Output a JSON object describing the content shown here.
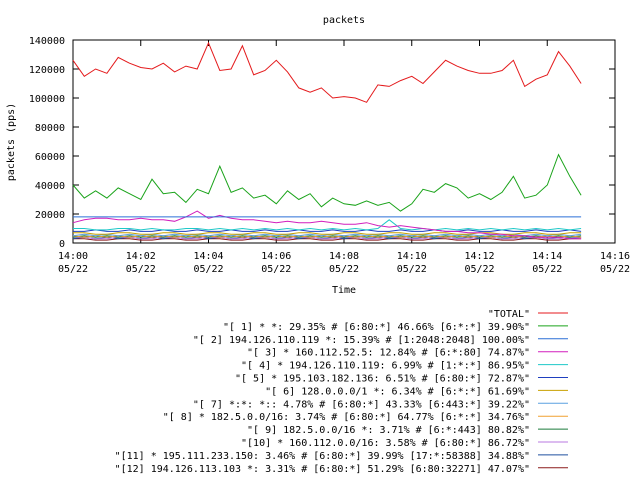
{
  "chart_data": {
    "type": "line",
    "title": "packets",
    "xlabel": "Time",
    "ylabel": "packets (pps)",
    "ylim": [
      0,
      140000
    ],
    "xlim": [
      "14:00",
      "14:16"
    ],
    "y_ticks": [
      "0",
      "20000",
      "40000",
      "60000",
      "80000",
      "100000",
      "120000",
      "140000"
    ],
    "x_ticks": [
      {
        "time": "14:00",
        "date": "05/22"
      },
      {
        "time": "14:02",
        "date": "05/22"
      },
      {
        "time": "14:04",
        "date": "05/22"
      },
      {
        "time": "14:06",
        "date": "05/22"
      },
      {
        "time": "14:08",
        "date": "05/22"
      },
      {
        "time": "14:10",
        "date": "05/22"
      },
      {
        "time": "14:12",
        "date": "05/22"
      },
      {
        "time": "14:14",
        "date": "05/22"
      },
      {
        "time": "14:16",
        "date": "05/22"
      }
    ],
    "grid": false,
    "legend_position": "bottom",
    "x": [
      "14:00:00",
      "14:00:20",
      "14:00:40",
      "14:01:00",
      "14:01:20",
      "14:01:40",
      "14:02:00",
      "14:02:20",
      "14:02:40",
      "14:03:00",
      "14:03:20",
      "14:03:40",
      "14:04:00",
      "14:04:20",
      "14:04:40",
      "14:05:00",
      "14:05:20",
      "14:05:40",
      "14:06:00",
      "14:06:20",
      "14:06:40",
      "14:07:00",
      "14:07:20",
      "14:07:40",
      "14:08:00",
      "14:08:20",
      "14:08:40",
      "14:09:00",
      "14:09:20",
      "14:09:40",
      "14:10:00",
      "14:10:20",
      "14:10:40",
      "14:11:00",
      "14:11:20",
      "14:11:40",
      "14:12:00",
      "14:12:20",
      "14:12:40",
      "14:13:00",
      "14:13:20",
      "14:13:40",
      "14:14:00",
      "14:14:20",
      "14:14:40",
      "14:15:00"
    ],
    "series": [
      {
        "name": "\"TOTAL\"",
        "color": "#e41a1c",
        "values": [
          126000,
          115000,
          120000,
          117000,
          128000,
          124000,
          121000,
          120000,
          124000,
          118000,
          122000,
          120000,
          138000,
          119000,
          120000,
          136000,
          116000,
          119000,
          126000,
          118000,
          107000,
          104000,
          107000,
          100000,
          101000,
          100000,
          97000,
          109000,
          108000,
          112000,
          115000,
          110000,
          118000,
          126000,
          122000,
          119000,
          117000,
          117000,
          119000,
          126000,
          108000,
          113000,
          116000,
          132000,
          122000,
          110000
        ]
      },
      {
        "name": "\"[ 1] * *: 29.35% # [6:80:*] 46.66% [6:*:*] 39.90%\"",
        "color": "#1aa31a",
        "values": [
          40000,
          31000,
          36000,
          31000,
          38000,
          34000,
          30000,
          44000,
          34000,
          35000,
          28000,
          37000,
          34000,
          53000,
          35000,
          38000,
          31000,
          33000,
          27000,
          36000,
          30000,
          34000,
          25000,
          31000,
          27000,
          26000,
          29000,
          26000,
          28000,
          22000,
          27000,
          37000,
          35000,
          41000,
          38000,
          31000,
          34000,
          30000,
          35000,
          46000,
          31000,
          33000,
          40000,
          61000,
          46000,
          33000
        ]
      },
      {
        "name": "\"[ 2] 194.126.110.119 *: 15.39% # [1:2048:2048] 100.00%\"",
        "color": "#2a6fd6",
        "values": [
          18000,
          18000,
          18000,
          18000,
          18000,
          18000,
          18000,
          18000,
          18000,
          18000,
          18000,
          18000,
          18000,
          18000,
          18000,
          18000,
          18000,
          18000,
          18000,
          18000,
          18000,
          18000,
          18000,
          18000,
          18000,
          18000,
          18000,
          18000,
          18000,
          18000,
          18000,
          18000,
          18000,
          18000,
          18000,
          18000,
          18000,
          18000,
          18000,
          18000,
          18000,
          18000,
          18000,
          18000,
          18000,
          18000
        ]
      },
      {
        "name": "\"[ 3] * 160.112.52.5: 12.84% # [6:*:80] 74.87%\"",
        "color": "#d21fbd",
        "values": [
          14000,
          16000,
          17000,
          17000,
          16000,
          16000,
          17000,
          16000,
          16000,
          15000,
          18000,
          22000,
          17000,
          19000,
          17000,
          16000,
          16000,
          15000,
          14000,
          15000,
          14000,
          14000,
          15000,
          14000,
          13000,
          13000,
          14000,
          12000,
          11000,
          12000,
          11000,
          10000,
          9000,
          8000,
          8000,
          7000,
          7000,
          6000,
          6000,
          5000,
          5000,
          4000,
          4000,
          4000,
          3000,
          3000
        ]
      },
      {
        "name": "\"[ 4] * 194.126.110.119: 6.99% # [1:*:*] 86.95%\"",
        "color": "#1ec8c8",
        "values": [
          10000,
          10000,
          9000,
          9000,
          10000,
          10000,
          9000,
          10000,
          9000,
          9000,
          10000,
          10000,
          9000,
          10000,
          9000,
          10000,
          9000,
          10000,
          9000,
          10000,
          9000,
          10000,
          9000,
          10000,
          9000,
          10000,
          9000,
          10000,
          16000,
          10000,
          9000,
          10000,
          9000,
          10000,
          9000,
          10000,
          9000,
          10000,
          9000,
          10000,
          9000,
          10000,
          9000,
          10000,
          9000,
          10000
        ]
      },
      {
        "name": "\"[ 5] * 195.103.182.136: 6.51% # [6:80:*] 72.87%\"",
        "color": "#1f3fbf",
        "values": [
          8000,
          8000,
          9000,
          8000,
          8000,
          9000,
          8000,
          8000,
          9000,
          8000,
          8000,
          9000,
          8000,
          8000,
          9000,
          8000,
          8000,
          9000,
          8000,
          8000,
          9000,
          8000,
          8000,
          9000,
          8000,
          8000,
          9000,
          8000,
          8000,
          9000,
          8000,
          8000,
          9000,
          8000,
          8000,
          9000,
          8000,
          8000,
          9000,
          8000,
          8000,
          9000,
          8000,
          8000,
          9000,
          8000
        ]
      },
      {
        "name": "\"[ 6] 128.0.0.0/1 *: 6.34% # [6:*:*] 61.69%\"",
        "color": "#c8a000",
        "values": [
          7000,
          7000,
          6000,
          6000,
          7000,
          7000,
          6000,
          6000,
          7000,
          7000,
          6000,
          6000,
          7000,
          7000,
          6000,
          6000,
          7000,
          7000,
          6000,
          6000,
          7000,
          7000,
          6000,
          6000,
          7000,
          7000,
          6000,
          6000,
          7000,
          7000,
          6000,
          6000,
          7000,
          7000,
          6000,
          6000,
          7000,
          7000,
          6000,
          6000,
          7000,
          7000,
          6000,
          6000,
          7000,
          7000
        ]
      },
      {
        "name": "\"[ 7] *:*: *:: 4.78% # [6:80:*] 43.33% [6:443:*] 39.22%\"",
        "color": "#5aa0e0",
        "values": [
          5000,
          6000,
          5000,
          6000,
          5000,
          6000,
          5000,
          6000,
          5000,
          6000,
          5000,
          6000,
          5000,
          6000,
          5000,
          6000,
          5000,
          6000,
          5000,
          6000,
          5000,
          6000,
          5000,
          6000,
          5000,
          6000,
          5000,
          6000,
          5000,
          6000,
          5000,
          6000,
          5000,
          6000,
          5000,
          6000,
          5000,
          6000,
          5000,
          6000,
          5000,
          6000,
          5000,
          6000,
          5000,
          6000
        ]
      },
      {
        "name": "\"[ 8] * 182.5.0.0/16: 3.74% # [6:80:*] 64.77% [6:*:*] 34.76%\"",
        "color": "#f0a030",
        "values": [
          5000,
          4000,
          5000,
          4000,
          5000,
          4000,
          5000,
          4000,
          5000,
          4000,
          5000,
          4000,
          5000,
          4000,
          5000,
          4000,
          5000,
          4000,
          5000,
          4000,
          5000,
          4000,
          5000,
          4000,
          5000,
          4000,
          5000,
          4000,
          5000,
          4000,
          5000,
          4000,
          5000,
          4000,
          5000,
          4000,
          5000,
          4000,
          5000,
          4000,
          5000,
          4000,
          5000,
          4000,
          5000,
          4000
        ]
      },
      {
        "name": "\"[ 9] 182.5.0.0/16 *: 3.71% # [6:*:443] 80.82%\"",
        "color": "#1a7a3a",
        "values": [
          4000,
          5000,
          4000,
          5000,
          4000,
          5000,
          4000,
          5000,
          4000,
          5000,
          4000,
          5000,
          4000,
          5000,
          4000,
          5000,
          4000,
          5000,
          4000,
          5000,
          4000,
          5000,
          4000,
          5000,
          4000,
          5000,
          4000,
          5000,
          4000,
          5000,
          4000,
          5000,
          4000,
          5000,
          4000,
          5000,
          4000,
          5000,
          4000,
          5000,
          4000,
          5000,
          4000,
          5000,
          4000,
          5000
        ]
      },
      {
        "name": "\"[10] * 160.112.0.0/16: 3.58% # [6:80:*] 86.72%\"",
        "color": "#b878e0",
        "values": [
          4000,
          4000,
          3000,
          3000,
          4000,
          4000,
          3000,
          3000,
          4000,
          4000,
          3000,
          3000,
          4000,
          4000,
          3000,
          3000,
          4000,
          4000,
          3000,
          3000,
          4000,
          4000,
          3000,
          3000,
          4000,
          4000,
          3000,
          3000,
          4000,
          4000,
          3000,
          3000,
          4000,
          4000,
          3000,
          3000,
          4000,
          4000,
          3000,
          3000,
          4000,
          4000,
          3000,
          3000,
          4000,
          4000
        ]
      },
      {
        "name": "\"[11] * 195.111.233.150: 3.46% # [6:80:*] 39.99% [17:*:58388] 34.88%\"",
        "color": "#1f4f9f",
        "values": [
          3000,
          4000,
          3000,
          4000,
          3000,
          4000,
          3000,
          4000,
          3000,
          4000,
          3000,
          4000,
          3000,
          4000,
          3000,
          4000,
          3000,
          4000,
          3000,
          4000,
          3000,
          4000,
          3000,
          4000,
          3000,
          4000,
          3000,
          4000,
          3000,
          4000,
          3000,
          4000,
          3000,
          4000,
          3000,
          4000,
          3000,
          4000,
          3000,
          4000,
          3000,
          4000,
          3000,
          4000,
          3000,
          4000
        ]
      },
      {
        "name": "\"[12] 194.126.113.103 *: 3.31% # [6:80:*] 51.29% [6:80:32271] 47.07%\"",
        "color": "#8b1a1a",
        "values": [
          3000,
          3000,
          2000,
          2000,
          3000,
          3000,
          2000,
          2000,
          3000,
          3000,
          2000,
          2000,
          3000,
          3000,
          2000,
          2000,
          3000,
          3000,
          2000,
          2000,
          3000,
          3000,
          2000,
          2000,
          3000,
          3000,
          2000,
          2000,
          3000,
          3000,
          2000,
          2000,
          3000,
          3000,
          2000,
          2000,
          3000,
          3000,
          2000,
          2000,
          3000,
          3000,
          2000,
          2000,
          3000,
          3000
        ]
      }
    ]
  }
}
